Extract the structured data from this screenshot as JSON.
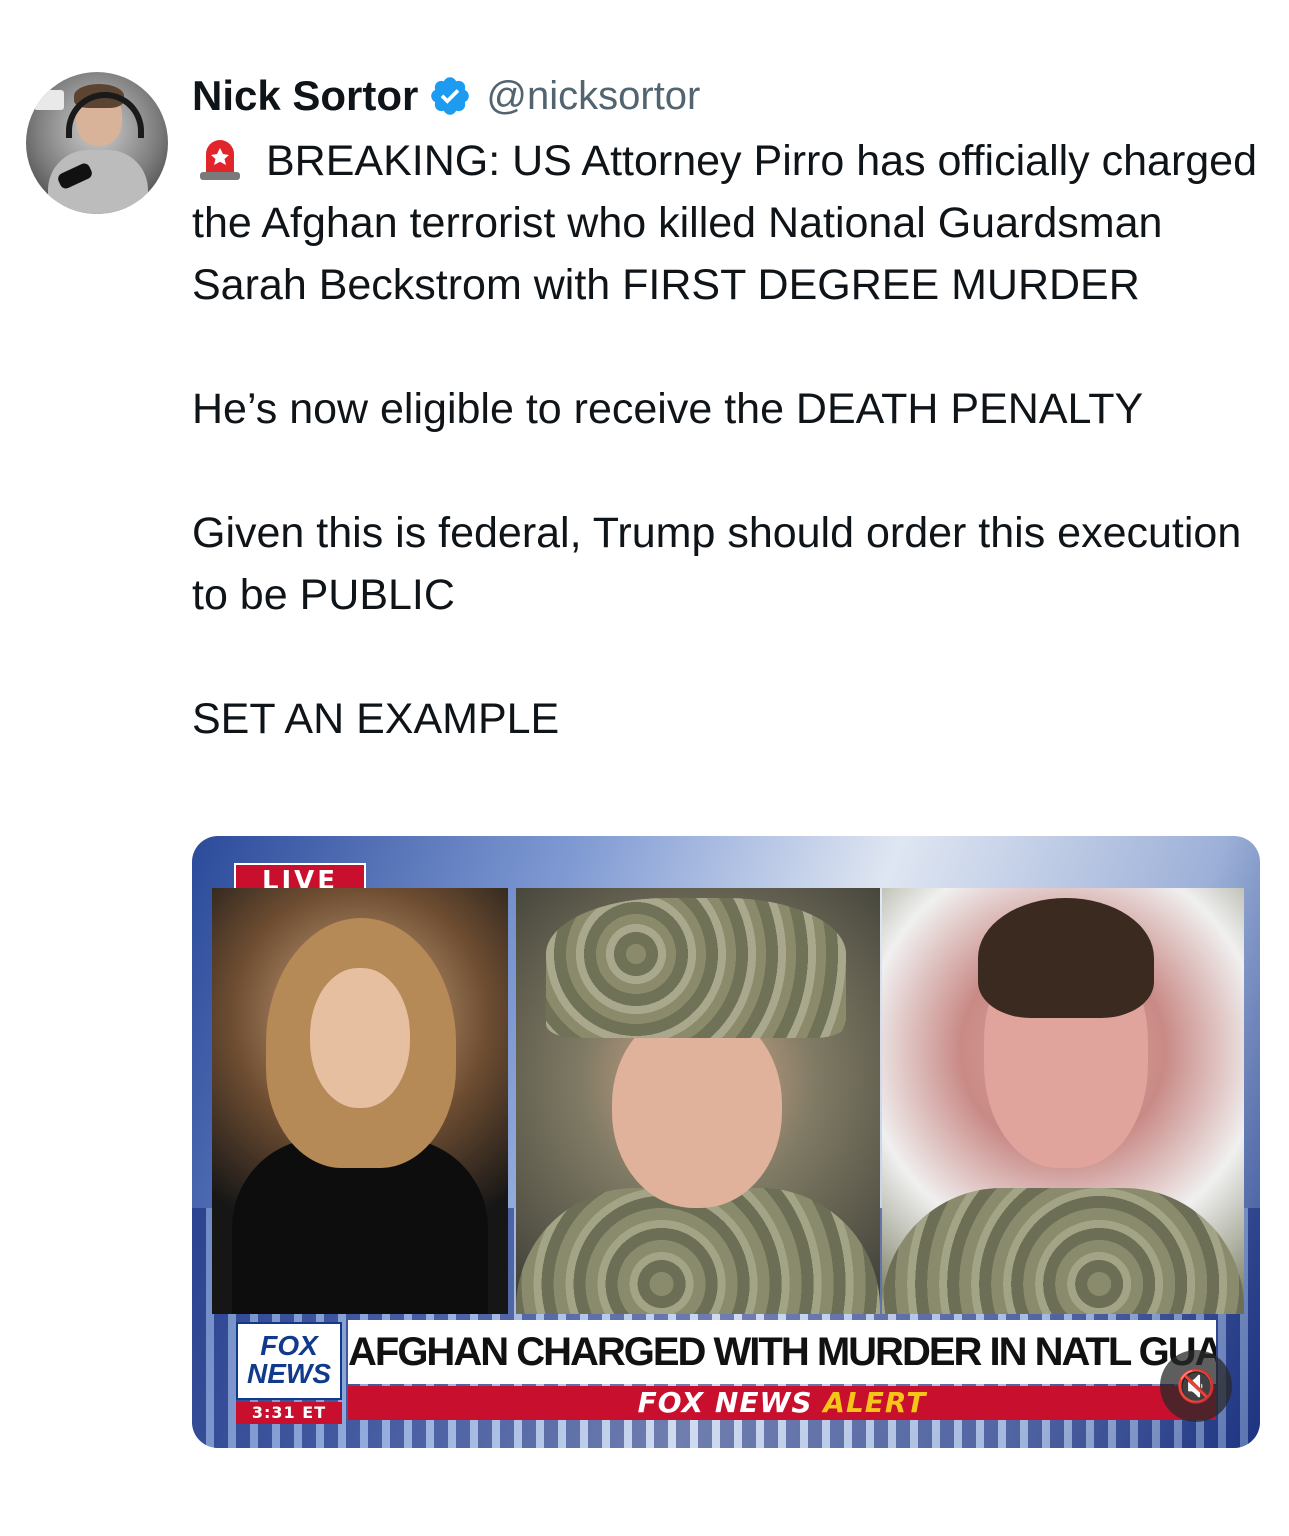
{
  "author": {
    "name": "Nick Sortor",
    "handle": "@nicksortor",
    "verified": true
  },
  "tweet": {
    "icon": "police-light-emoji",
    "paragraphs": [
      "BREAKING: US Attorney Pirro has officially charged the Afghan terrorist who killed National Guardsman Sarah Beckstrom with FIRST DEGREE MURDER",
      "He’s now eligible to receive the DEATH PENALTY",
      "Given this is federal, Trump should order this execution to be PUBLIC",
      "SET AN EXAMPLE"
    ]
  },
  "media": {
    "live_label": "LIVE",
    "logo_line1": "FOX",
    "logo_line2": "NEWS",
    "time": "3:31 ET",
    "headline": "AFGHAN CHARGED WITH MURDER IN NATL GUARD SHOOTING",
    "alert_prefix": "FOX NEWS",
    "alert_word": "ALERT",
    "mute_icon": "muted-speaker-icon"
  },
  "colors": {
    "verified_blue": "#1d9bf0",
    "fox_red": "#c8102e",
    "fox_blue": "#123a8c",
    "alert_yellow": "#f5c518"
  }
}
